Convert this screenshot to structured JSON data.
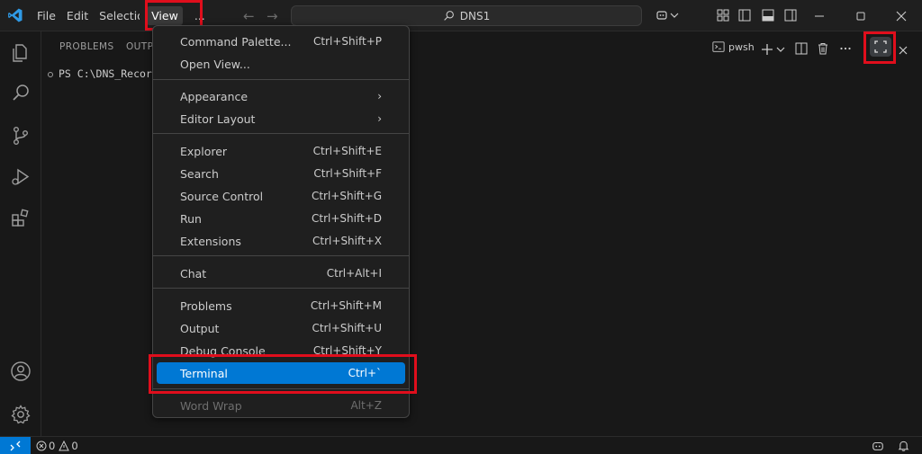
{
  "titlebar": {
    "menu": [
      "File",
      "Edit",
      "Selection",
      "View",
      "..."
    ],
    "search_text": "DNS1"
  },
  "panel": {
    "tabs": [
      "PROBLEMS",
      "OUTPUT"
    ],
    "terminal_line": "PS C:\\DNS_Records",
    "shell_label": "pwsh"
  },
  "view_menu": {
    "groups": [
      [
        {
          "label": "Command Palette...",
          "shortcut": "Ctrl+Shift+P"
        },
        {
          "label": "Open View...",
          "shortcut": ""
        }
      ],
      [
        {
          "label": "Appearance",
          "shortcut": "",
          "submenu": true
        },
        {
          "label": "Editor Layout",
          "shortcut": "",
          "submenu": true
        }
      ],
      [
        {
          "label": "Explorer",
          "shortcut": "Ctrl+Shift+E"
        },
        {
          "label": "Search",
          "shortcut": "Ctrl+Shift+F"
        },
        {
          "label": "Source Control",
          "shortcut": "Ctrl+Shift+G"
        },
        {
          "label": "Run",
          "shortcut": "Ctrl+Shift+D"
        },
        {
          "label": "Extensions",
          "shortcut": "Ctrl+Shift+X"
        }
      ],
      [
        {
          "label": "Chat",
          "shortcut": "Ctrl+Alt+I"
        }
      ],
      [
        {
          "label": "Problems",
          "shortcut": "Ctrl+Shift+M"
        },
        {
          "label": "Output",
          "shortcut": "Ctrl+Shift+U"
        },
        {
          "label": "Debug Console",
          "shortcut": "Ctrl+Shift+Y"
        },
        {
          "label": "Terminal",
          "shortcut": "Ctrl+`",
          "highlighted": true
        }
      ],
      [
        {
          "label": "Word Wrap",
          "shortcut": "Alt+Z",
          "disabled": true
        }
      ]
    ]
  },
  "statusbar": {
    "errors": "0",
    "warnings": "0"
  },
  "colors": {
    "accent": "#0078d4",
    "highlight_box": "#e00e1c",
    "background": "#181818"
  }
}
